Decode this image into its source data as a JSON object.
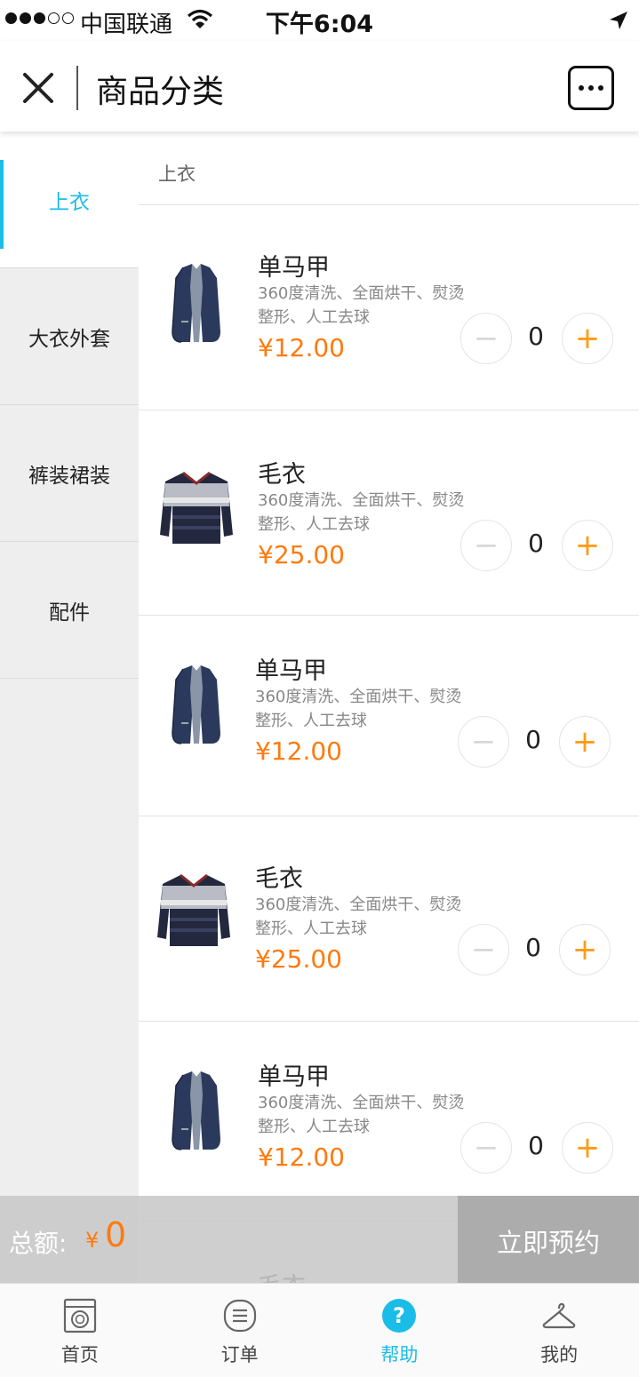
{
  "status_bar": {
    "carrier": "中国联通",
    "time": "下午6:04",
    "signal_dots_filled": 3,
    "signal_dots_total": 5,
    "icons": [
      "wifi-icon",
      "location-arrow-icon"
    ]
  },
  "nav": {
    "title": "商品分类",
    "icons": [
      "close-icon",
      "more-icon"
    ]
  },
  "sidebar": {
    "items": [
      {
        "label": "上衣",
        "active": true
      },
      {
        "label": "大衣外套",
        "active": false
      },
      {
        "label": "裤装裙装",
        "active": false
      },
      {
        "label": "配件",
        "active": false
      }
    ],
    "accent_color": "#1bbde8"
  },
  "content": {
    "section_title": "上衣",
    "products": [
      {
        "name": "单马甲",
        "desc": "360度清洗、全面烘干、熨烫整形、人工去球",
        "price": "¥12.00",
        "qty": "0",
        "image": "vest-image"
      },
      {
        "name": "毛衣",
        "desc": "360度清洗、全面烘干、熨烫整形、人工去球",
        "price": "¥25.00",
        "qty": "0",
        "image": "sweater-image"
      },
      {
        "name": "单马甲",
        "desc": "360度清洗、全面烘干、熨烫整形、人工去球",
        "price": "¥12.00",
        "qty": "0",
        "image": "vest-image"
      },
      {
        "name": "毛衣",
        "desc": "360度清洗、全面烘干、熨烫整形、人工去球",
        "price": "¥25.00",
        "qty": "0",
        "image": "sweater-image"
      },
      {
        "name": "单马甲",
        "desc": "360度清洗、全面烘干、熨烫整形、人工去球",
        "price": "¥12.00",
        "qty": "0",
        "image": "vest-image"
      },
      {
        "name": "毛衣",
        "desc": "",
        "price": "",
        "qty": "",
        "image": "sweater-image"
      }
    ],
    "price_color": "#ff7a0e",
    "plus_color": "#ff9c14",
    "minus_label": "−",
    "plus_label": "+"
  },
  "summary": {
    "total_label": "总额:",
    "currency": "¥",
    "amount": "0",
    "book_button": "立即预约"
  },
  "tabbar": {
    "tabs": [
      {
        "label": "首页",
        "icon": "washing-machine-icon",
        "active": false
      },
      {
        "label": "订单",
        "icon": "order-list-icon",
        "active": false
      },
      {
        "label": "帮助",
        "icon": "help-icon",
        "active": true
      },
      {
        "label": "我的",
        "icon": "hanger-icon",
        "active": false
      }
    ]
  }
}
